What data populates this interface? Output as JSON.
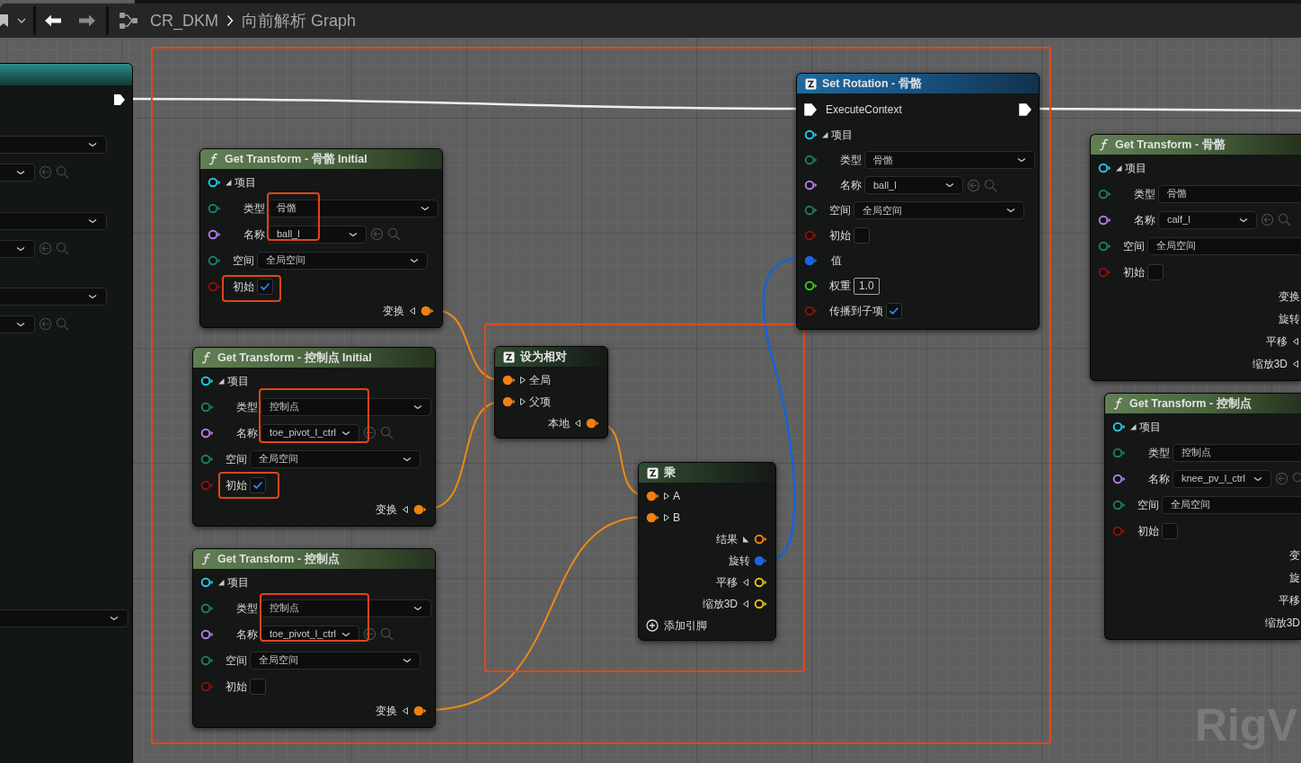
{
  "toolbar": {
    "breadcrumbs": [
      {
        "label": "CR_DKM"
      },
      {
        "label": "向前解析 Graph"
      }
    ]
  },
  "nodes": [
    {
      "kind": "function",
      "title": "Get Transform - 骨骼 Initial",
      "rows": [
        {
          "kind": "struct",
          "label": "项目",
          "color": "#1ec8e6",
          "connected": false,
          "expanded": true,
          "children": [
            {
              "kind": "enum",
              "label": "类型",
              "value": "骨骼",
              "color": "#1a7a6e",
              "connected": false
            },
            {
              "kind": "name",
              "label": "名称",
              "value": "ball_l",
              "color": "#b07ae8",
              "connected": false
            }
          ]
        },
        {
          "kind": "enum",
          "label": "空间",
          "value": "全局空间",
          "color": "#1a7a6e",
          "connected": false
        },
        {
          "kind": "checkbox",
          "label": "初始",
          "checked": true,
          "color": "#8a1010",
          "connected": false
        },
        {
          "kind": "output",
          "label": "变换",
          "expanded": false,
          "color": "#f08010",
          "connected": true
        }
      ]
    },
    {
      "kind": "function",
      "title": "Get Transform - 控制点 Initial",
      "rows": [
        {
          "kind": "struct",
          "label": "项目",
          "color": "#1ec8e6",
          "connected": false,
          "expanded": true,
          "children": [
            {
              "kind": "enum",
              "label": "类型",
              "value": "控制点",
              "color": "#1a7a6e",
              "connected": false
            },
            {
              "kind": "name",
              "label": "名称",
              "value": "toe_pivot_l_ctrl",
              "color": "#b07ae8",
              "connected": false
            }
          ]
        },
        {
          "kind": "enum",
          "label": "空间",
          "value": "全局空间",
          "color": "#1a7a6e",
          "connected": false
        },
        {
          "kind": "checkbox",
          "label": "初始",
          "checked": true,
          "color": "#8a1010",
          "connected": false
        },
        {
          "kind": "output",
          "label": "变换",
          "expanded": false,
          "color": "#f08010",
          "connected": true
        }
      ]
    },
    {
      "kind": "function",
      "title": "Get Transform - 控制点",
      "rows": [
        {
          "kind": "struct",
          "label": "项目",
          "color": "#1ec8e6",
          "connected": false,
          "expanded": true,
          "children": [
            {
              "kind": "enum",
              "label": "类型",
              "value": "控制点",
              "color": "#1a7a6e",
              "connected": false
            },
            {
              "kind": "name",
              "label": "名称",
              "value": "toe_pivot_l_ctrl",
              "color": "#b07ae8",
              "connected": false
            }
          ]
        },
        {
          "kind": "enum",
          "label": "空间",
          "value": "全局空间",
          "color": "#1a7a6e",
          "connected": false
        },
        {
          "kind": "checkbox",
          "label": "初始",
          "checked": false,
          "color": "#8a1010",
          "connected": false
        },
        {
          "kind": "output",
          "label": "变换",
          "expanded": false,
          "color": "#f08010",
          "connected": true
        }
      ]
    },
    {
      "kind": "math",
      "title": "设为相对",
      "rows": [
        {
          "kind": "input",
          "label": "全局",
          "expanded": false,
          "color": "#f08010",
          "connected": true
        },
        {
          "kind": "input",
          "label": "父项",
          "expanded": false,
          "color": "#f08010",
          "connected": true
        },
        {
          "kind": "output",
          "label": "本地",
          "expanded": false,
          "color": "#f08010",
          "connected": true
        }
      ]
    },
    {
      "kind": "math",
      "title": "乘",
      "rows": [
        {
          "kind": "input",
          "label": "A",
          "expanded": false,
          "color": "#f08010",
          "connected": true
        },
        {
          "kind": "input",
          "label": "B",
          "expanded": false,
          "color": "#f08010",
          "connected": true
        },
        {
          "kind": "output",
          "label": "结果",
          "expanded": true,
          "color": "#f08010",
          "connected": false,
          "children": [
            {
              "kind": "output",
              "label": "旋转",
              "color": "#1a64e0",
              "connected": true
            },
            {
              "kind": "output",
              "label": "平移",
              "expanded": false,
              "color": "#e0c020",
              "connected": false
            },
            {
              "kind": "output",
              "label": "缩放3D",
              "expanded": false,
              "color": "#e0c020",
              "connected": false
            }
          ]
        },
        {
          "kind": "add_pin",
          "label": "添加引脚"
        }
      ]
    },
    {
      "kind": "set",
      "title": "Set Rotation - 骨骼",
      "rows": [
        {
          "kind": "exec",
          "label": "ExecuteContext",
          "connected": true
        },
        {
          "kind": "struct",
          "label": "项目",
          "color": "#1ec8e6",
          "connected": false,
          "expanded": true,
          "children": [
            {
              "kind": "enum",
              "label": "类型",
              "value": "骨骼",
              "color": "#1a7a6e",
              "connected": false
            },
            {
              "kind": "name",
              "label": "名称",
              "value": "ball_l",
              "color": "#b07ae8",
              "connected": false
            }
          ]
        },
        {
          "kind": "enum",
          "label": "空间",
          "value": "全局空间",
          "color": "#1a7a6e",
          "connected": false
        },
        {
          "kind": "checkbox",
          "label": "初始",
          "checked": false,
          "color": "#8a1010",
          "connected": false
        },
        {
          "kind": "input",
          "label": "值",
          "color": "#1a64e0",
          "connected": true
        },
        {
          "kind": "number",
          "label": "权重",
          "value": "1.0",
          "color": "#40c020",
          "connected": false
        },
        {
          "kind": "checkbox",
          "label": "传播到子项",
          "checked": true,
          "color": "#8a1010",
          "connected": false
        }
      ]
    },
    {
      "kind": "function",
      "title": "Get Transform - 骨骼",
      "rows": [
        {
          "kind": "struct",
          "label": "项目",
          "color": "#1ec8e6",
          "connected": false,
          "expanded": true,
          "children": [
            {
              "kind": "enum",
              "label": "类型",
              "value": "骨骼",
              "color": "#1a7a6e",
              "connected": false
            },
            {
              "kind": "name",
              "label": "名称",
              "value": "calf_l",
              "color": "#b07ae8",
              "connected": false
            }
          ]
        },
        {
          "kind": "enum",
          "label": "空间",
          "value": "全局空间",
          "color": "#1a7a6e",
          "connected": false
        },
        {
          "kind": "checkbox",
          "label": "初始",
          "checked": false,
          "color": "#8a1010",
          "connected": false
        },
        {
          "kind": "output",
          "label": "变换"
        },
        {
          "kind": "output",
          "label": "旋转"
        },
        {
          "kind": "output",
          "label": "平移",
          "expanded": false
        },
        {
          "kind": "output",
          "label": "缩放3D",
          "expanded": false
        }
      ]
    },
    {
      "kind": "function",
      "title": "Get Transform - 控制点",
      "rows": [
        {
          "kind": "struct",
          "label": "项目",
          "color": "#1ec8e6",
          "connected": false,
          "expanded": true,
          "children": [
            {
              "kind": "enum",
              "label": "类型",
              "value": "控制点",
              "color": "#1a7a6e",
              "connected": false
            },
            {
              "kind": "name",
              "label": "名称",
              "value": "knee_pv_l_ctrl",
              "color": "#b07ae8",
              "connected": false
            }
          ]
        },
        {
          "kind": "enum",
          "label": "空间",
          "value": "全局空间",
          "color": "#1a7a6e",
          "connected": false
        },
        {
          "kind": "checkbox",
          "label": "初始",
          "checked": false,
          "color": "#8a1010",
          "connected": false
        },
        {
          "kind": "output",
          "label": "变"
        },
        {
          "kind": "output",
          "label": "旋"
        },
        {
          "kind": "output",
          "label": "平移"
        },
        {
          "kind": "output",
          "label": "缩放3D"
        }
      ]
    }
  ],
  "corner_label": "RigV"
}
